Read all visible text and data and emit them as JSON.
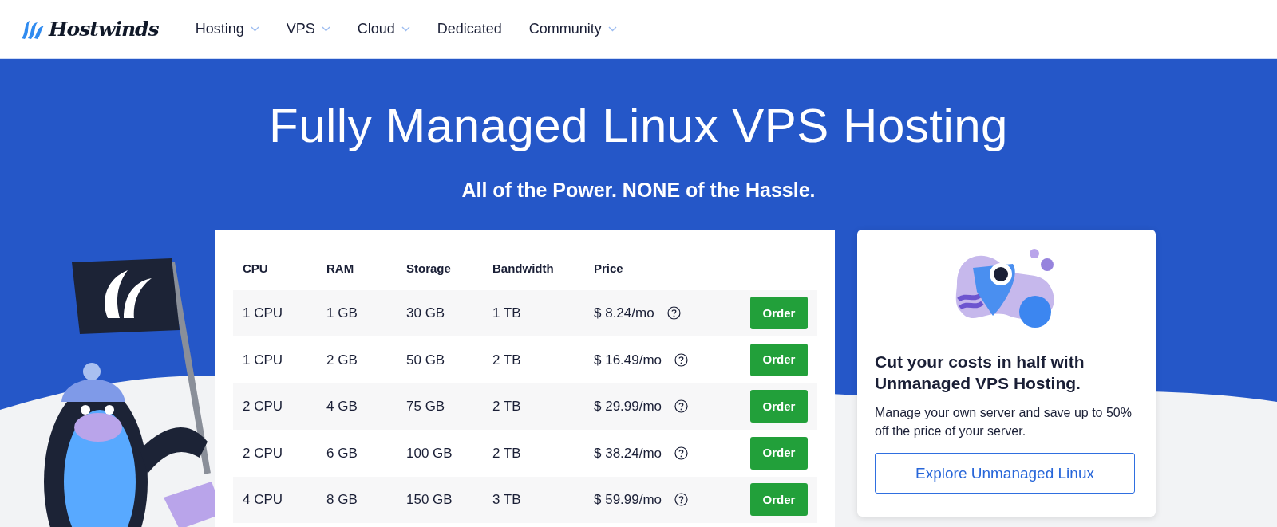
{
  "brand": {
    "name": "Hostwinds"
  },
  "nav": [
    {
      "label": "Hosting",
      "has_dropdown": true
    },
    {
      "label": "VPS",
      "has_dropdown": true
    },
    {
      "label": "Cloud",
      "has_dropdown": true
    },
    {
      "label": "Dedicated",
      "has_dropdown": false
    },
    {
      "label": "Community",
      "has_dropdown": true
    }
  ],
  "hero": {
    "title": "Fully Managed Linux VPS Hosting",
    "subtitle": "All of the Power. NONE of the Hassle."
  },
  "plans": {
    "columns": [
      "CPU",
      "RAM",
      "Storage",
      "Bandwidth",
      "Price"
    ],
    "rows": [
      {
        "cpu": "1 CPU",
        "ram": "1 GB",
        "storage": "30 GB",
        "bandwidth": "1 TB",
        "price": "$ 8.24/mo",
        "action": "Order"
      },
      {
        "cpu": "1 CPU",
        "ram": "2 GB",
        "storage": "50 GB",
        "bandwidth": "2 TB",
        "price": "$ 16.49/mo",
        "action": "Order"
      },
      {
        "cpu": "2 CPU",
        "ram": "4 GB",
        "storage": "75 GB",
        "bandwidth": "2 TB",
        "price": "$ 29.99/mo",
        "action": "Order"
      },
      {
        "cpu": "2 CPU",
        "ram": "6 GB",
        "storage": "100 GB",
        "bandwidth": "2 TB",
        "price": "$ 38.24/mo",
        "action": "Order"
      },
      {
        "cpu": "4 CPU",
        "ram": "8 GB",
        "storage": "150 GB",
        "bandwidth": "3 TB",
        "price": "$ 59.99/mo",
        "action": "Order"
      }
    ]
  },
  "promo": {
    "heading": "Cut your costs in half with Unmanaged VPS Hosting.",
    "text": "Manage your own server and save up to 50% off the price of your server.",
    "button": "Explore Unmanaged Linux"
  }
}
